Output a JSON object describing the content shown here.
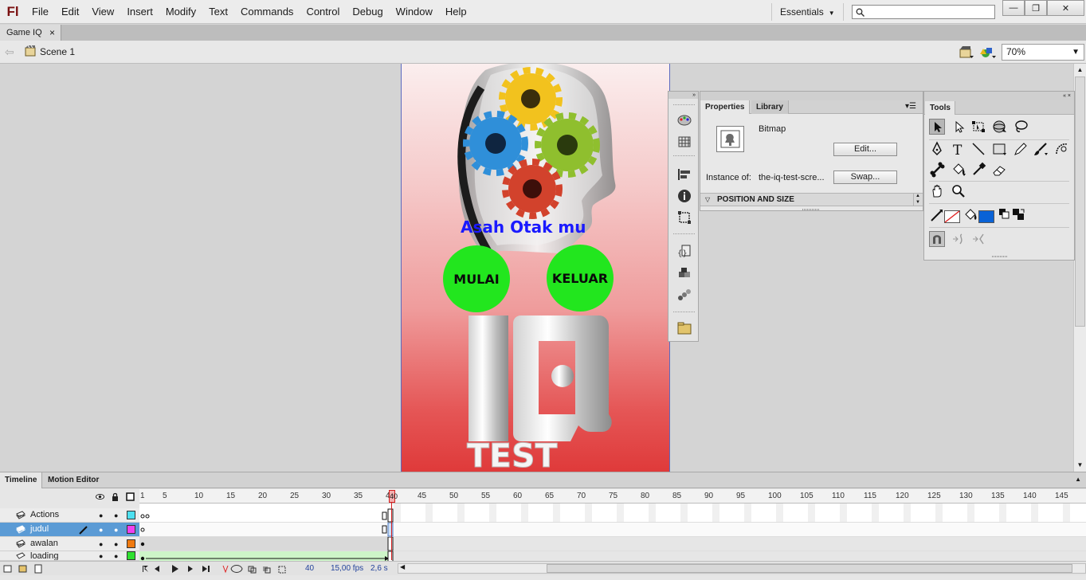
{
  "app": {
    "logo": "Fl",
    "brand_color": "#7a1010"
  },
  "menu": [
    "File",
    "Edit",
    "View",
    "Insert",
    "Modify",
    "Text",
    "Commands",
    "Control",
    "Debug",
    "Window",
    "Help"
  ],
  "workspace": {
    "label": "Essentials"
  },
  "search": {
    "placeholder": "",
    "value": ""
  },
  "window_controls": {
    "minimize": "—",
    "maximize": "❐",
    "close": "✕"
  },
  "document_tab": {
    "label": "Game IQ",
    "close": "×"
  },
  "editbar": {
    "scene_label": "Scene 1",
    "zoom_value": "70%"
  },
  "stage": {
    "background_top": "#fbeeee",
    "background_bottom": "#df3a3a",
    "headline": "Asah Otak mu",
    "headline_color": "#1a1aff",
    "buttons": [
      {
        "label": "MULAI",
        "color": "#22e61e"
      },
      {
        "label": "KELUAR",
        "color": "#22e61e"
      }
    ],
    "logo_text": "IQ",
    "logo_subtext": "TEST"
  },
  "properties_panel": {
    "tabs": [
      "Properties",
      "Library"
    ],
    "active_tab": "Properties",
    "type_label": "Bitmap",
    "edit_button": "Edit...",
    "instance_label": "Instance of:",
    "instance_value": "the-iq-test-scre...",
    "swap_button": "Swap...",
    "section_label": "POSITION AND SIZE"
  },
  "tools_panel": {
    "title": "Tools",
    "tools": [
      "selection-tool",
      "subselection-tool",
      "free-transform-tool",
      "3d-rotation-tool",
      "lasso-tool",
      "pen-tool",
      "text-tool",
      "line-tool",
      "rectangle-tool",
      "pencil-tool",
      "brush-tool",
      "deco-tool",
      "bone-tool",
      "paint-bucket-tool",
      "eyedropper-tool",
      "eraser-tool",
      "hand-tool",
      "zoom-tool"
    ],
    "stroke_color": "none",
    "fill_color": "#0a62d6"
  },
  "timeline": {
    "tabs": [
      "Timeline",
      "Motion Editor"
    ],
    "active_tab": "Timeline",
    "frame_labels": [
      "1",
      "5",
      "10",
      "15",
      "20",
      "25",
      "30",
      "35",
      "40",
      "45",
      "50",
      "55",
      "60",
      "65",
      "70",
      "75",
      "80",
      "85",
      "90",
      "95",
      "100",
      "105",
      "110",
      "115",
      "120",
      "125",
      "130",
      "135",
      "140",
      "145"
    ],
    "playhead_frame": "40",
    "layers": [
      {
        "name": "Actions",
        "color": "#4de0f0",
        "selected": false
      },
      {
        "name": "judul",
        "color": "#f040f0",
        "selected": true
      },
      {
        "name": "awalan",
        "color": "#f07a10",
        "selected": false
      },
      {
        "name": "loading",
        "color": "#30e030",
        "selected": false
      }
    ],
    "footer": {
      "current_frame": "40",
      "fps": "15,00 fps",
      "elapsed": "2,6 s"
    }
  }
}
